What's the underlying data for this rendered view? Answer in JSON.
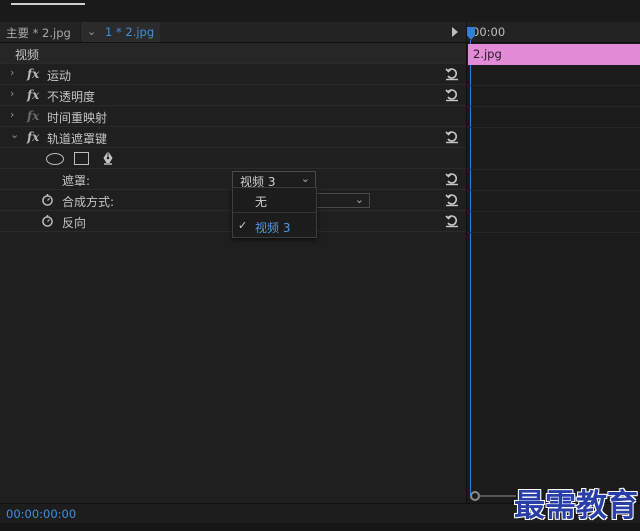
{
  "tabs": {
    "master": "主要 * 2.jpg",
    "clip_chevron": "⌄",
    "clip": "1 * 2.jpg"
  },
  "section_label": "视频",
  "effects": [
    {
      "label": "运动",
      "enabled": true
    },
    {
      "label": "不透明度",
      "enabled": true
    },
    {
      "label": "时间重映射",
      "enabled": false
    },
    {
      "label": "轨道遮罩键",
      "enabled": true,
      "expanded": true
    }
  ],
  "track_matte": {
    "mask_label": "遮罩:",
    "mask_value": "视频 3",
    "composite_label": "合成方式:",
    "reverse_label": "反向"
  },
  "dropdown": {
    "options": [
      "无",
      "视频 3"
    ],
    "selected": "视频 3"
  },
  "timeline": {
    "ruler_timecode": "00:00",
    "clip_name": "2.jpg",
    "clip_color": "#e48bd8"
  },
  "status": {
    "timecode": "00:00:00:00"
  },
  "watermark": "最需教育",
  "colors": {
    "accent_blue": "#3f8fe0",
    "playhead": "#2f7fd6"
  },
  "icons": {
    "fx": "fx",
    "chevron": "›",
    "expanded": "⌄",
    "check": "✓"
  }
}
